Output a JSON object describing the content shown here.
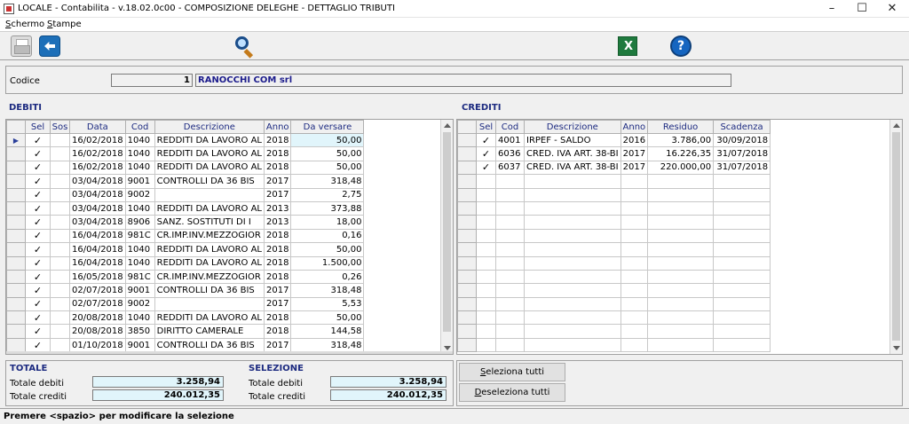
{
  "window": {
    "title": "LOCALE - Contabilita - v.18.02.0c00 - COMPOSIZIONE DELEGHE - DETTAGLIO TRIBUTI",
    "minimize": "–",
    "maximize": "☐",
    "close": "✕"
  },
  "menu": [
    {
      "key": "S",
      "rest": "chermo"
    },
    {
      "key": "S",
      "rest": "tampe"
    }
  ],
  "toolbar": {
    "icons": [
      "print-icon",
      "back-icon",
      "search-icon",
      "excel-icon",
      "help-icon"
    ]
  },
  "header": {
    "codice_label": "Codice",
    "codice_value": "1",
    "company_name": "RANOCCHI COM srl"
  },
  "debiti": {
    "title": "DEBITI",
    "columns": [
      "Sel",
      "Sos",
      "Data",
      "Cod",
      "Descrizione",
      "Anno",
      "Da versare"
    ],
    "rows": [
      {
        "sel": "✓",
        "sos": "",
        "data": "16/02/2018",
        "cod": "1040",
        "descr": "REDDITI DA LAVORO AL",
        "anno": "2018",
        "importo": "50,00"
      },
      {
        "sel": "✓",
        "sos": "",
        "data": "16/02/2018",
        "cod": "1040",
        "descr": "REDDITI DA LAVORO AL",
        "anno": "2018",
        "importo": "50,00"
      },
      {
        "sel": "✓",
        "sos": "",
        "data": "16/02/2018",
        "cod": "1040",
        "descr": "REDDITI DA LAVORO AL",
        "anno": "2018",
        "importo": "50,00"
      },
      {
        "sel": "✓",
        "sos": "",
        "data": "03/04/2018",
        "cod": "9001",
        "descr": "CONTROLLI DA 36 BIS",
        "anno": "2017",
        "importo": "318,48"
      },
      {
        "sel": "✓",
        "sos": "",
        "data": "03/04/2018",
        "cod": "9002",
        "descr": "",
        "anno": "2017",
        "importo": "2,75"
      },
      {
        "sel": "✓",
        "sos": "",
        "data": "03/04/2018",
        "cod": "1040",
        "descr": "REDDITI DA LAVORO AL",
        "anno": "2013",
        "importo": "373,88"
      },
      {
        "sel": "✓",
        "sos": "",
        "data": "03/04/2018",
        "cod": "8906",
        "descr": "SANZ. SOSTITUTI DI I",
        "anno": "2013",
        "importo": "18,00"
      },
      {
        "sel": "✓",
        "sos": "",
        "data": "16/04/2018",
        "cod": "981C",
        "descr": "CR.IMP.INV.MEZZOGIOR",
        "anno": "2018",
        "importo": "0,16"
      },
      {
        "sel": "✓",
        "sos": "",
        "data": "16/04/2018",
        "cod": "1040",
        "descr": "REDDITI DA LAVORO AL",
        "anno": "2018",
        "importo": "50,00"
      },
      {
        "sel": "✓",
        "sos": "",
        "data": "16/04/2018",
        "cod": "1040",
        "descr": "REDDITI DA LAVORO AL",
        "anno": "2018",
        "importo": "1.500,00"
      },
      {
        "sel": "✓",
        "sos": "",
        "data": "16/05/2018",
        "cod": "981C",
        "descr": "CR.IMP.INV.MEZZOGIOR",
        "anno": "2018",
        "importo": "0,26"
      },
      {
        "sel": "✓",
        "sos": "",
        "data": "02/07/2018",
        "cod": "9001",
        "descr": "CONTROLLI DA 36 BIS",
        "anno": "2017",
        "importo": "318,48"
      },
      {
        "sel": "✓",
        "sos": "",
        "data": "02/07/2018",
        "cod": "9002",
        "descr": "",
        "anno": "2017",
        "importo": "5,53"
      },
      {
        "sel": "✓",
        "sos": "",
        "data": "20/08/2018",
        "cod": "1040",
        "descr": "REDDITI DA LAVORO AL",
        "anno": "2018",
        "importo": "50,00"
      },
      {
        "sel": "✓",
        "sos": "",
        "data": "20/08/2018",
        "cod": "3850",
        "descr": "DIRITTO CAMERALE",
        "anno": "2018",
        "importo": "144,58"
      },
      {
        "sel": "✓",
        "sos": "",
        "data": "01/10/2018",
        "cod": "9001",
        "descr": "CONTROLLI DA 36 BIS",
        "anno": "2017",
        "importo": "318,48"
      }
    ]
  },
  "crediti": {
    "title": "CREDITI",
    "columns": [
      "Sel",
      "Cod",
      "Descrizione",
      "Anno",
      "Residuo",
      "Scadenza"
    ],
    "rows": [
      {
        "sel": "✓",
        "cod": "4001",
        "descr": "IRPEF - SALDO",
        "anno": "2016",
        "residuo": "3.786,00",
        "scadenza": "30/09/2018"
      },
      {
        "sel": "✓",
        "cod": "6036",
        "descr": "CRED. IVA ART. 38-BI",
        "anno": "2017",
        "residuo": "16.226,35",
        "scadenza": "31/07/2018"
      },
      {
        "sel": "✓",
        "cod": "6037",
        "descr": "CRED. IVA ART. 38-BI",
        "anno": "2017",
        "residuo": "220.000,00",
        "scadenza": "31/07/2018"
      }
    ],
    "empty_rows": 13
  },
  "totale": {
    "title": "TOTALE",
    "debiti_label": "Totale debiti",
    "debiti_value": "3.258,94",
    "crediti_label": "Totale crediti",
    "crediti_value": "240.012,35"
  },
  "selezione": {
    "title": "SELEZIONE",
    "debiti_label": "Totale debiti",
    "debiti_value": "3.258,94",
    "crediti_label": "Totale crediti",
    "crediti_value": "240.012,35"
  },
  "buttons": {
    "select_all_key": "S",
    "select_all_rest": "eleziona tutti",
    "deselect_all_key": "D",
    "deselect_all_rest": "eseleziona tutti"
  },
  "status": {
    "text": "Premere <spazio> per modificare la selezione"
  }
}
